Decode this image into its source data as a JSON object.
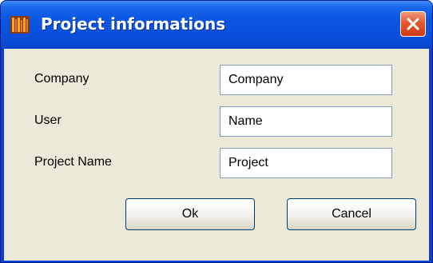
{
  "window": {
    "title": "Project informations",
    "app_icon": "bookshelf-icon",
    "close_icon": "close-icon"
  },
  "form": {
    "fields": [
      {
        "label": "Company",
        "value": "Company"
      },
      {
        "label": "User",
        "value": "Name"
      },
      {
        "label": "Project Name",
        "value": "Project"
      }
    ]
  },
  "buttons": {
    "ok_label": "Ok",
    "cancel_label": "Cancel"
  },
  "colors": {
    "titlebar": "#0a50dd",
    "close_button": "#e2582f",
    "client_background": "#ece9d8",
    "input_border": "#7f9db9",
    "button_border": "#003c74"
  }
}
